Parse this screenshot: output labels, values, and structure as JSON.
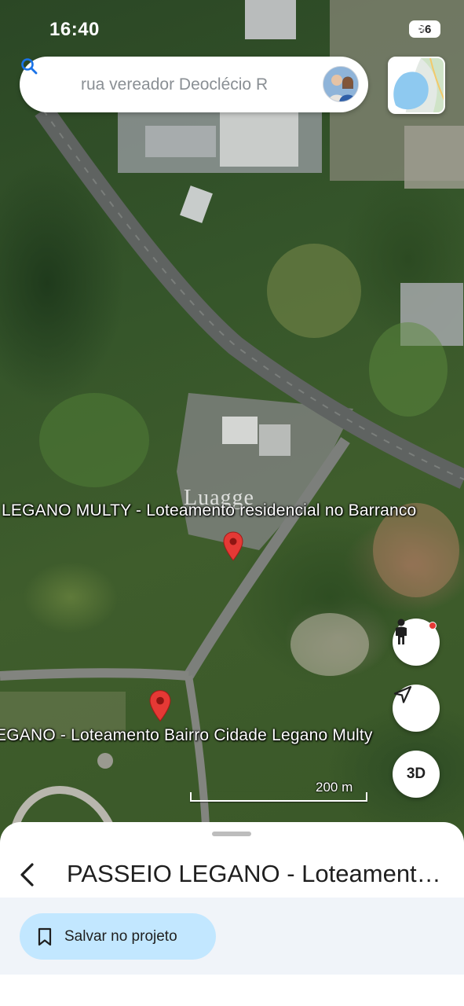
{
  "status_bar": {
    "time": "16:40",
    "battery": "66",
    "icons": [
      "signal-icon",
      "wifi-icon",
      "battery-icon"
    ]
  },
  "search": {
    "text": "rua vereador Deoclécio R",
    "icon": "search-icon"
  },
  "map": {
    "type": "satellite",
    "labels": [
      "LEGANO MULTY - Loteamento residencial no Barranco",
      "EGANO - Loteamento Bairro Cidade Legano Multy"
    ],
    "watermark": "Luagge",
    "scale": "200 m",
    "pin_color": "#e53935"
  },
  "controls": {
    "street_view_icon": "person-icon",
    "location_icon": "navigation-arrow-icon",
    "three_d": "3D"
  },
  "sheet": {
    "title": "PASSEIO LEGANO - Loteament…",
    "save_button": "Salvar no projeto",
    "save_button_color": "#c2e7ff",
    "strip_color": "#f0f4f9"
  }
}
